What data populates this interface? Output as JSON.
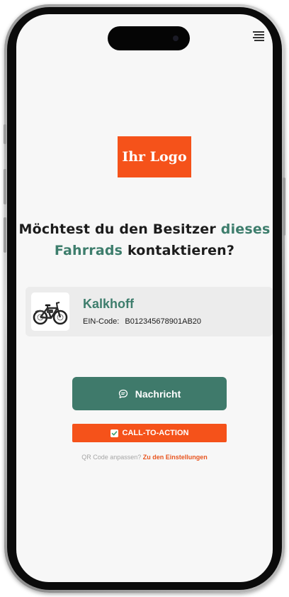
{
  "header": {
    "logo_text": "Ihr Logo",
    "menu_icon": "menu-lines-icon"
  },
  "headline": {
    "part1": "Möchtest du den Besitzer ",
    "accent1": "dieses",
    "accent2": "Fahrrads",
    "part2": " kontaktieren?"
  },
  "owner_card": {
    "image": "bicycle-image",
    "brand": "Kalkhoff",
    "ein_label": "EIN-Code:",
    "ein_value": "B012345678901AB20"
  },
  "actions": {
    "message_label": "Nachricht",
    "message_icon": "chat-bubble-icon",
    "cta_label": "CALL-TO-ACTION",
    "cta_icon": "checkbox-icon"
  },
  "footer": {
    "prompt": "QR Code anpassen?",
    "link": "Zu den Einstellungen"
  },
  "colors": {
    "accent_orange": "#f5521a",
    "accent_green": "#3d7d6c",
    "card_bg": "#ececec"
  }
}
